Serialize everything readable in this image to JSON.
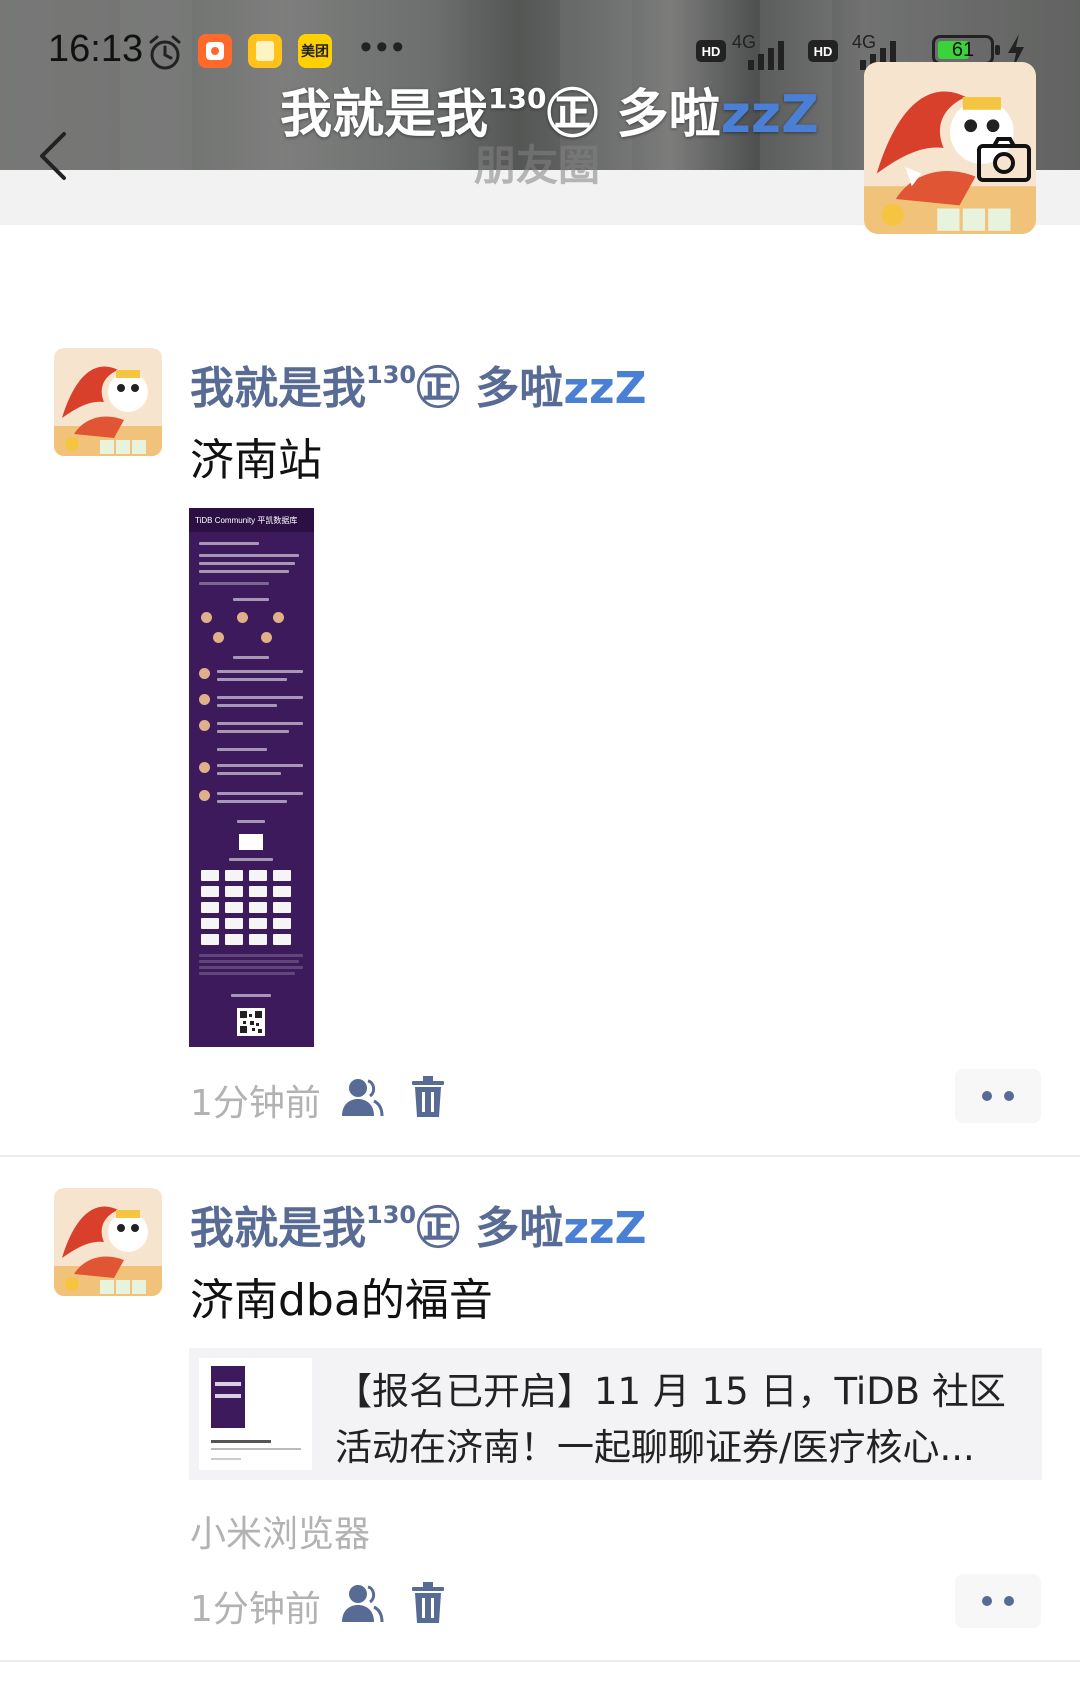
{
  "status_bar": {
    "time": "16:13",
    "app_icons": [
      "alarm-icon",
      "orange-app-icon",
      "yellow-notes-icon",
      "meituan-icon"
    ],
    "meituan_label": "美团",
    "overflow": "•••",
    "sim1": {
      "hd": "HD",
      "network": "4G"
    },
    "sim2": {
      "hd": "HD",
      "network": "4G"
    },
    "battery_level": "61",
    "battery_fraction": 0.61,
    "charging": true
  },
  "header": {
    "cover_user_name": "我就是我",
    "cover_user_sup": "130",
    "cover_user_tail": "㊣ 多啦",
    "cover_zz": "zzZ",
    "page_title": "朋友圈"
  },
  "posts": [
    {
      "user_name": "我就是我",
      "user_sup": "130",
      "user_tail": "㊣ 多啦",
      "user_zz": "zzZ",
      "text": "济南站",
      "media": "poster-image",
      "poster_header": "TiDB Community  平凯数据库",
      "time": "1分钟前"
    },
    {
      "user_name": "我就是我",
      "user_sup": "130",
      "user_tail": "㊣ 多啦",
      "user_zz": "zzZ",
      "text": "济南dba的福音",
      "link_title": "【报名已开启】11 月 15 日，TiDB 社区活动在济南！一起聊聊证券/医疗核心...",
      "link_source": "小米浏览器",
      "time": "1分钟前"
    }
  ],
  "colors": {
    "name_link": "#576b95",
    "time_gray": "#b2b2b2",
    "poster_bg": "#3d1a5b",
    "zz_blue": "#4a7fd6"
  }
}
